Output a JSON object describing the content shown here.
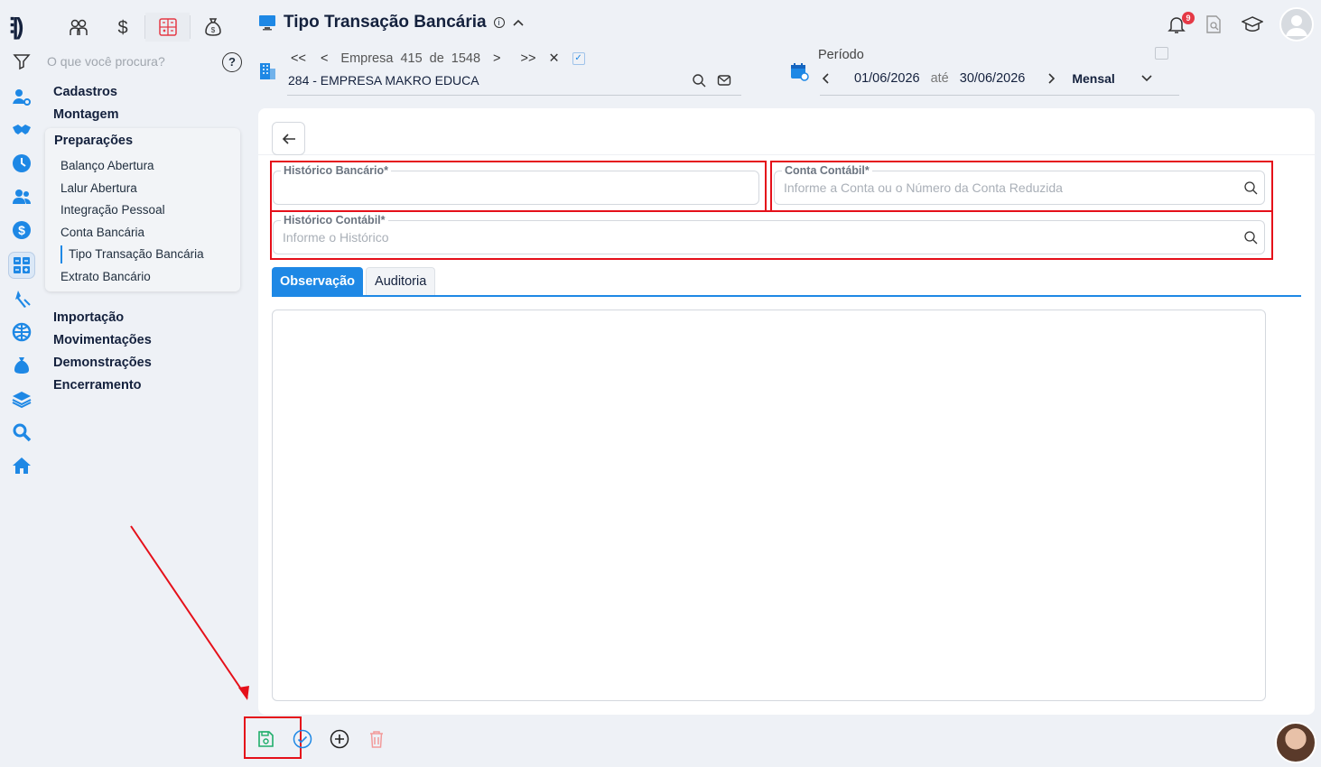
{
  "app": {
    "logo_text": "⫶|)",
    "title": "Tipo Transação Bancária",
    "notification_count": "9"
  },
  "search": {
    "placeholder": "O que você procura?",
    "help": "?"
  },
  "menu": {
    "groups_top": [
      "Cadastros",
      "Montagem"
    ],
    "open_group": "Preparações",
    "items": [
      "Balanço Abertura",
      "Lalur Abertura",
      "Integração Pessoal",
      "Conta Bancária",
      "Tipo Transação Bancária",
      "Extrato Bancário"
    ],
    "current_item": "Tipo Transação Bancária",
    "groups_bottom": [
      "Importação",
      "Movimentações",
      "Demonstrações",
      "Encerramento"
    ]
  },
  "company": {
    "first": "<<",
    "prev": "<",
    "label": "Empresa",
    "index": "415",
    "of": "de",
    "total": "1548",
    "next": ">",
    "last": ">>",
    "clear": "✕",
    "name": "284 - EMPRESA MAKRO EDUCA"
  },
  "period": {
    "label": "Período",
    "start": "01/06/2026",
    "until": "até",
    "end": "30/06/2026",
    "mode": "Mensal"
  },
  "form": {
    "historico_bancario": {
      "label": "Histórico Bancário*",
      "value": ""
    },
    "conta_contabil": {
      "label": "Conta Contábil*",
      "placeholder": "Informe a Conta ou o Número da Conta Reduzida"
    },
    "historico_contabil": {
      "label": "Histórico Contábil*",
      "placeholder": "Informe o Histórico"
    }
  },
  "tabs": [
    {
      "label": "Observação",
      "active": true
    },
    {
      "label": "Auditoria",
      "active": false
    }
  ],
  "icons": {
    "rail": [
      "people-gear-icon",
      "handshake-icon",
      "clock-icon",
      "users-icon",
      "dollar-icon",
      "calculator-icon",
      "tools-icon",
      "globe-icon",
      "moneybag-icon",
      "layers-icon",
      "search-icon",
      "home-icon"
    ],
    "modules": [
      "people-icon",
      "dollar-icon",
      "calculator-icon",
      "moneybag-icon"
    ],
    "actions": [
      "save-icon",
      "check-circle-icon",
      "plus-circle-icon",
      "trash-icon"
    ]
  },
  "colors": {
    "accent": "#1e88e5",
    "highlight": "#e5101a",
    "save": "#1fae6b",
    "delete": "#f29a9a"
  }
}
